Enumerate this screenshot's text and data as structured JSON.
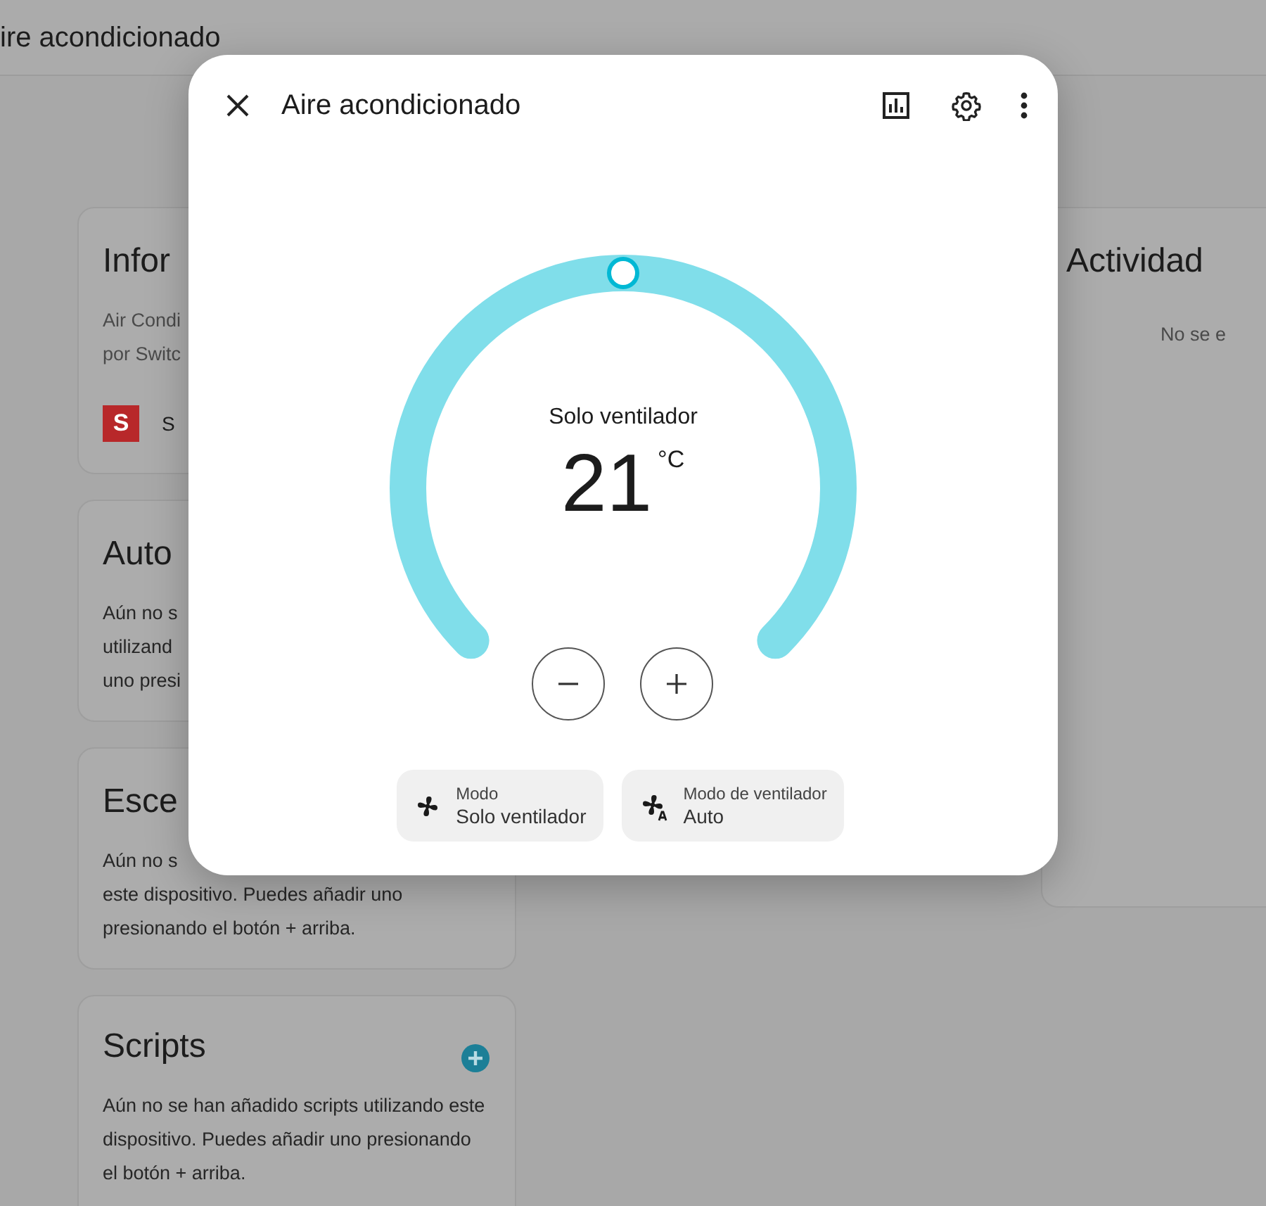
{
  "page_header": {
    "title": "ire acondicionado"
  },
  "left_cards": [
    {
      "kind": "info",
      "title": "Infor",
      "lines": [
        "Air Condi",
        "por Switc"
      ],
      "logo_letter": "S",
      "device": "S",
      "add_button": false
    },
    {
      "kind": "text",
      "title": "Auto",
      "lines": [
        "Aún no s",
        "utilizand",
        "uno presi"
      ],
      "add_button": false
    },
    {
      "kind": "text",
      "title": "Esce",
      "lines": [
        "Aún no s",
        "este dispositivo. Puedes añadir uno",
        "presionando el botón + arriba."
      ],
      "add_button": false
    },
    {
      "kind": "text",
      "title": "Scripts",
      "lines": [
        "Aún no se han añadido scripts utilizando este",
        "dispositivo. Puedes añadir uno presionando",
        "el botón + arriba."
      ],
      "add_button": true
    }
  ],
  "right_card": {
    "title": "Actividad",
    "text": "No se e"
  },
  "dialog": {
    "title": "Aire acondicionado",
    "dial": {
      "mode": "Solo ventilador",
      "temperature": "21",
      "unit": "°C",
      "level": 0.5
    },
    "chips": [
      {
        "kind": "mode",
        "label": "Modo",
        "value": "Solo ventilador"
      },
      {
        "kind": "fan",
        "label": "Modo de ventilador",
        "value": "Auto"
      }
    ]
  }
}
